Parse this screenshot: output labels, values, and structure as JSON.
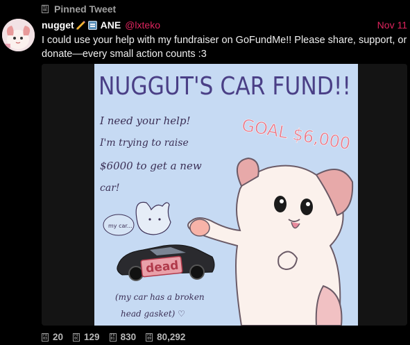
{
  "pinned": {
    "icon": "pin-icon",
    "label": "Pinned Tweet"
  },
  "tweet": {
    "author_name": "nugget",
    "author_suffix": "ANE",
    "handle": "@lxteko",
    "date": "Nov 11",
    "text": "I could use your help with my fundraiser on GoFundMe!! Please share, support, or donate—every small action counts :3",
    "image": {
      "title": "NUGGUT'S CAR FUND!!",
      "line1": "I need your help!",
      "line2": "I'm trying to raise",
      "line3": "$6000 to get a new",
      "line4": "car!",
      "goal": "GOAL $6,000",
      "bubble": "my car...",
      "dead_label": "dead",
      "caption1": "(my car has a broken",
      "caption2": "head gasket) ♡"
    }
  },
  "stats": {
    "replies": "20",
    "retweets": "129",
    "likes": "830",
    "views": "80,292"
  },
  "colors": {
    "accent": "#e0245e",
    "art_background": "#c6daf3",
    "art_ink": "#4a3f86",
    "goal_pink": "#e87a8a"
  }
}
